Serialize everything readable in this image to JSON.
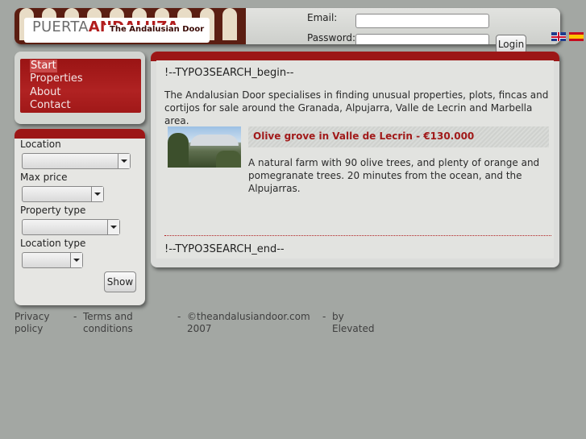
{
  "header": {
    "logo_word_1": "PUERTA",
    "logo_word_2": "ANDALUZA",
    "logo_tagline": "The Andalusian Door",
    "email_label": "Email:",
    "password_label": "Password:",
    "login_label": "Login",
    "flags": [
      "flag-uk-icon",
      "flag-spain-icon"
    ]
  },
  "nav": {
    "items": [
      {
        "label": "Start"
      },
      {
        "label": "Properties"
      },
      {
        "label": "About"
      },
      {
        "label": "Contact"
      }
    ]
  },
  "search": {
    "location_label": "Location",
    "max_price_label": "Max price",
    "property_type_label": "Property type",
    "location_type_label": "Location type",
    "location_value": "",
    "max_price_value": "",
    "property_type_value": "",
    "location_type_value": "",
    "show_label": "Show"
  },
  "main": {
    "search_begin_marker": "!--TYPO3SEARCH_begin--",
    "intro": "The Andalusian Door specialises in finding unusual properties, plots, fincas and cortijos for sale around the Granada, Alpujarra, Valle de Lecrin and Marbella area.",
    "listing": {
      "title": "Olive grove in Valle de Lecrin - €130.000",
      "description": "A natural farm with 90 olive trees, and plenty of orange and pomegranate trees. 20 minutes from the ocean, and the Alpujarras."
    },
    "search_end_marker": "!--TYPO3SEARCH_end--"
  },
  "footer": {
    "privacy": "Privacy policy",
    "terms": "Terms and conditions",
    "copyright": "©theandalusiandoor.com 2007",
    "by": "by Elevated",
    "separator": "-"
  },
  "colors": {
    "accent_red": "#9c1616",
    "background": "#a3a7a3",
    "panel": "#dcdddb"
  }
}
